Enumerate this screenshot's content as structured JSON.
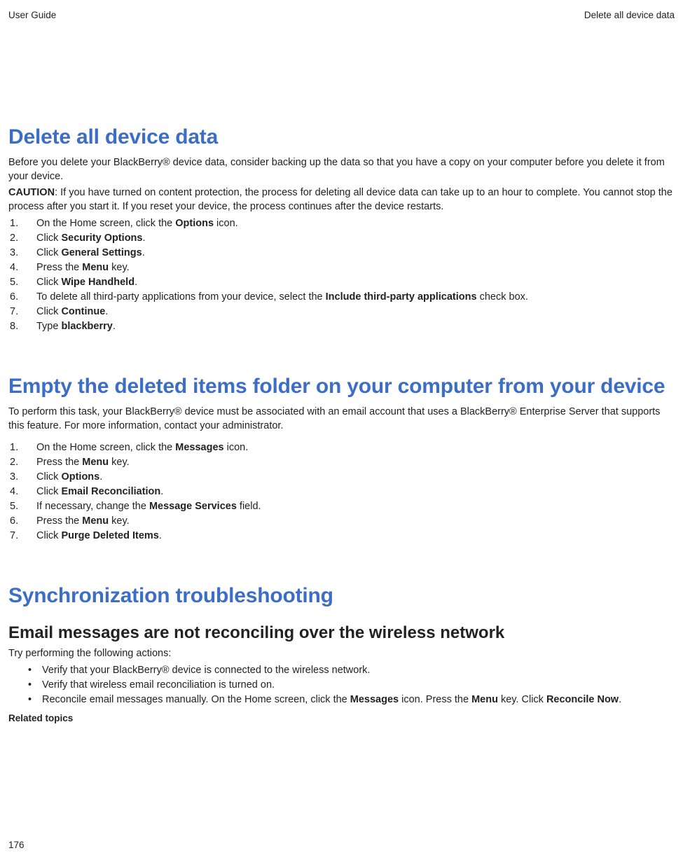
{
  "header": {
    "left": "User Guide",
    "right": "Delete all device data"
  },
  "footer": {
    "page": "176"
  },
  "s1": {
    "title": "Delete all device data",
    "intro": "Before you delete your BlackBerry® device data, consider backing up the data so that you have a copy on your computer before you delete it from your device.",
    "caution_label": "CAUTION",
    "caution_text": ":  If you have turned on content protection, the process for deleting all device data can take up to an hour to complete. You cannot stop the process after you start it. If you reset your device, the process continues after the device restarts.",
    "steps": {
      "s1a": "On the Home screen, click the ",
      "s1b": "Options",
      "s1c": " icon.",
      "s2a": "Click ",
      "s2b": "Security Options",
      "s2c": ".",
      "s3a": "Click ",
      "s3b": "General Settings",
      "s3c": ".",
      "s4a": "Press the ",
      "s4b": "Menu",
      "s4c": " key.",
      "s5a": "Click ",
      "s5b": "Wipe Handheld",
      "s5c": ".",
      "s6a": "To delete all third-party applications from your device, select the ",
      "s6b": "Include third-party applications",
      "s6c": " check box.",
      "s7a": "Click ",
      "s7b": "Continue",
      "s7c": ".",
      "s8a": "Type ",
      "s8b": "blackberry",
      "s8c": "."
    }
  },
  "s2": {
    "title": "Empty the deleted items folder on your computer from your device",
    "intro": "To perform this task, your BlackBerry® device must be associated with an email account that uses a BlackBerry® Enterprise Server that supports this feature. For more information, contact your administrator.",
    "steps": {
      "s1a": "On the Home screen, click the ",
      "s1b": "Messages",
      "s1c": " icon.",
      "s2a": "Press the ",
      "s2b": "Menu",
      "s2c": " key.",
      "s3a": "Click ",
      "s3b": "Options",
      "s3c": ".",
      "s4a": "Click ",
      "s4b": "Email Reconciliation",
      "s4c": ".",
      "s5a": "If necessary, change the ",
      "s5b": "Message Services",
      "s5c": " field.",
      "s6a": "Press the ",
      "s6b": "Menu",
      "s6c": " key.",
      "s7a": "Click ",
      "s7b": "Purge Deleted Items",
      "s7c": "."
    }
  },
  "s3": {
    "title": "Synchronization troubleshooting",
    "h2": "Email messages are not reconciling over the wireless network",
    "intro": "Try performing the following actions:",
    "b1": "Verify that your BlackBerry® device is connected to the wireless network.",
    "b2": "Verify that wireless email reconciliation is turned on.",
    "b3a": "Reconcile email messages manually. On the Home screen, click the ",
    "b3b": "Messages",
    "b3c": " icon. Press the ",
    "b3d": "Menu",
    "b3e": " key. Click ",
    "b3f": "Reconcile Now",
    "b3g": ".",
    "related": "Related topics"
  }
}
